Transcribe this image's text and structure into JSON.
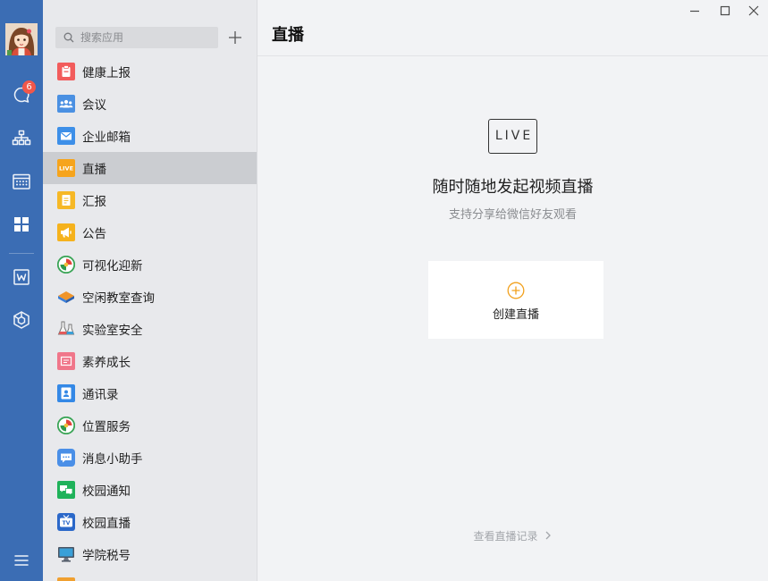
{
  "window": {
    "minimize_icon": "minimize-icon",
    "maximize_icon": "maximize-icon",
    "close_icon": "close-icon"
  },
  "rail": {
    "avatar": "avatar",
    "items": [
      {
        "id": "messages",
        "icon": "chat-bubble-icon",
        "badge": "6"
      },
      {
        "id": "contacts",
        "icon": "org-chart-icon"
      },
      {
        "id": "calendar",
        "icon": "calendar-icon"
      },
      {
        "id": "workbench",
        "icon": "apps-grid-icon",
        "active": true
      },
      {
        "id": "docs",
        "icon": "document-w-icon"
      },
      {
        "id": "mini-programs",
        "icon": "hexagon-icon"
      }
    ],
    "menu_icon": "menu-icon"
  },
  "apps": {
    "search": {
      "placeholder": "搜索应用",
      "icon": "search-icon"
    },
    "add_icon": "plus-icon",
    "selected_index": 3,
    "items": [
      {
        "label": "健康上报",
        "icon": "health-report-icon",
        "color": "#f25c5c"
      },
      {
        "label": "会议",
        "icon": "meeting-icon",
        "color": "#4a90e2"
      },
      {
        "label": "企业邮箱",
        "icon": "mail-icon",
        "color": "#3d8fe8"
      },
      {
        "label": "直播",
        "icon": "live-icon",
        "icon_text": "LIVE",
        "color": "#f6a41c"
      },
      {
        "label": "汇报",
        "icon": "report-icon",
        "color": "#f6b826"
      },
      {
        "label": "公告",
        "icon": "announcement-icon",
        "color": "#f5b21d"
      },
      {
        "label": "可视化迎新",
        "icon": "school-logo-icon"
      },
      {
        "label": "空闲教室查询",
        "icon": "book-icon"
      },
      {
        "label": "实验室安全",
        "icon": "flask-icon"
      },
      {
        "label": "素养成长",
        "icon": "growth-icon",
        "color": "#f0768a"
      },
      {
        "label": "通讯录",
        "icon": "contact-card-icon",
        "color": "#3488e6"
      },
      {
        "label": "位置服务",
        "icon": "school-logo-icon"
      },
      {
        "label": "消息小助手",
        "icon": "assistant-chat-icon",
        "color": "#4a8fe7"
      },
      {
        "label": "校园通知",
        "icon": "notice-chat-icon",
        "color": "#1fb25a"
      },
      {
        "label": "校园直播",
        "icon": "tv-icon",
        "icon_text": "TV",
        "color": "#2b68c9"
      },
      {
        "label": "学院税号",
        "icon": "computer-icon"
      },
      {
        "icon": "app-icon",
        "color": "#f0a030"
      }
    ]
  },
  "main": {
    "title": "直播",
    "hero": {
      "badge": "LIVE",
      "headline": "随时随地发起视频直播",
      "subtitle": "支持分享给微信好友观看",
      "create_label": "创建直播",
      "create_icon": "plus-circle-icon"
    },
    "history_link": "查看直播记录",
    "history_icon": "chevron-right-icon"
  },
  "colors": {
    "rail_bg": "#3b6db4",
    "panel_bg": "#e8e9ec",
    "selected_row": "#cbcdd1",
    "main_bg": "#f2f3f5",
    "badge_red": "#f2574a",
    "accent_orange": "#f2a11d"
  }
}
